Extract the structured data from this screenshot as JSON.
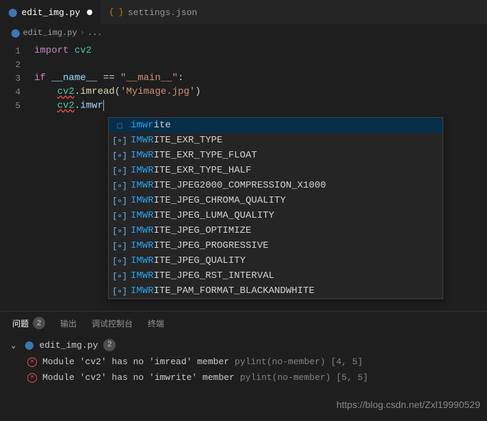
{
  "tabs": [
    {
      "label": "edit_img.py",
      "iconName": "python-file-icon",
      "active": true,
      "modified": true
    },
    {
      "label": "settings.json",
      "iconName": "json-file-icon",
      "active": false,
      "modified": false
    }
  ],
  "breadcrumb": {
    "file": "edit_img.py",
    "trail": "..."
  },
  "code": {
    "lines": [
      "1",
      "2",
      "3",
      "4",
      "5"
    ],
    "l1_kw": "import",
    "l1_mod": "cv2",
    "l3_if": "if",
    "l3_name": "__name__",
    "l3_eq": " == ",
    "l3_main": "\"__main__\"",
    "l3_colon": ":",
    "l4_cv2": "cv2",
    "l4_dot": ".",
    "l4_fn": "imread",
    "l4_open": "(",
    "l4_arg": "'Myimage.jpg'",
    "l4_close": ")",
    "l5_cv2": "cv2",
    "l5_dot": ".",
    "l5_prefix": "imwr"
  },
  "suggest": {
    "matchLen": 4,
    "items": [
      {
        "label": "imwrite",
        "kind": "method",
        "selected": true
      },
      {
        "label": "IMWRITE_EXR_TYPE",
        "kind": "variable"
      },
      {
        "label": "IMWRITE_EXR_TYPE_FLOAT",
        "kind": "variable"
      },
      {
        "label": "IMWRITE_EXR_TYPE_HALF",
        "kind": "variable"
      },
      {
        "label": "IMWRITE_JPEG2000_COMPRESSION_X1000",
        "kind": "variable"
      },
      {
        "label": "IMWRITE_JPEG_CHROMA_QUALITY",
        "kind": "variable"
      },
      {
        "label": "IMWRITE_JPEG_LUMA_QUALITY",
        "kind": "variable"
      },
      {
        "label": "IMWRITE_JPEG_OPTIMIZE",
        "kind": "variable"
      },
      {
        "label": "IMWRITE_JPEG_PROGRESSIVE",
        "kind": "variable"
      },
      {
        "label": "IMWRITE_JPEG_QUALITY",
        "kind": "variable"
      },
      {
        "label": "IMWRITE_JPEG_RST_INTERVAL",
        "kind": "variable"
      },
      {
        "label": "IMWRITE_PAM_FORMAT_BLACKANDWHITE",
        "kind": "variable"
      }
    ]
  },
  "panel": {
    "tabs": [
      {
        "label": "问题",
        "badge": "2",
        "active": true
      },
      {
        "label": "输出"
      },
      {
        "label": "调试控制台"
      },
      {
        "label": "终端"
      }
    ],
    "group": {
      "file": "edit_img.py",
      "count": "2"
    },
    "items": [
      {
        "msg": "Module 'cv2' has no 'imread' member",
        "source": "pylint(no-member)",
        "loc": "[4, 5]"
      },
      {
        "msg": "Module 'cv2' has no 'imwrite' member",
        "source": "pylint(no-member)",
        "loc": "[5, 5]"
      }
    ]
  },
  "watermark": "https://blog.csdn.net/Zxl19990529"
}
